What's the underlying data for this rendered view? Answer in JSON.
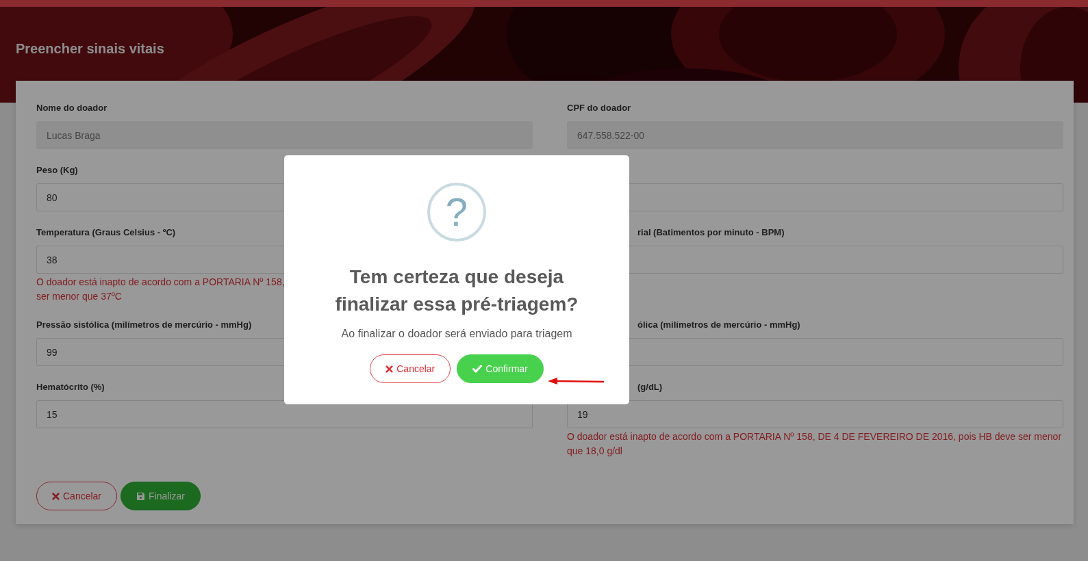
{
  "header": {
    "title": "Preencher sinais vitais"
  },
  "form": {
    "left": [
      {
        "kind": "input",
        "label": "Nome do doador",
        "value": "Lucas Braga",
        "disabled": true
      },
      {
        "kind": "input",
        "label": "Peso (Kg)",
        "value": "80",
        "disabled": false
      },
      {
        "kind": "input",
        "label": "Temperatura (Graus Celsius - ºC)",
        "value": "38",
        "disabled": false,
        "error_lines": [
          "O doador está inapto de acordo com a PORTARIA Nº 158,",
          "ser menor que 37ºC"
        ]
      },
      {
        "kind": "input",
        "label": "Pressão sistólica (milímetros de mercúrio - mmHg)",
        "value": "99",
        "disabled": false
      },
      {
        "kind": "input",
        "label": "Hematócrito (%)",
        "value": "15",
        "disabled": false
      }
    ],
    "right": [
      {
        "kind": "input",
        "label": "CPF do doador",
        "value": "647.558.522-00",
        "disabled": true
      },
      {
        "kind": "input"
      },
      {
        "kind": "input",
        "label": "rial (Batimentos por minuto - BPM)"
      },
      {
        "kind": "input",
        "label": "ólica (milímetros de mercúrio - mmHg)"
      },
      {
        "kind": "input",
        "label": "(g/dL)",
        "value": "19",
        "error_lines": [
          "O doador está inapto de acordo com a PORTARIA Nº 158, DE 4 DE FEVEREIRO DE 2016, pois HB deve ser menor",
          "que 18,0 g/dl"
        ]
      }
    ],
    "actions": [
      {
        "kind": "cancel",
        "label": "Cancelar"
      },
      {
        "kind": "save",
        "label": "Finalizar"
      }
    ]
  },
  "dialog": {
    "icon": "?",
    "title": "Tem certeza que deseja finalizar essa pré-triagem?",
    "text": "Ao finalizar o doador será enviado para triagem",
    "buttons": [
      {
        "kind": "cancel",
        "label": "Cancelar"
      },
      {
        "kind": "confirm",
        "label": "Confirmar"
      }
    ]
  }
}
